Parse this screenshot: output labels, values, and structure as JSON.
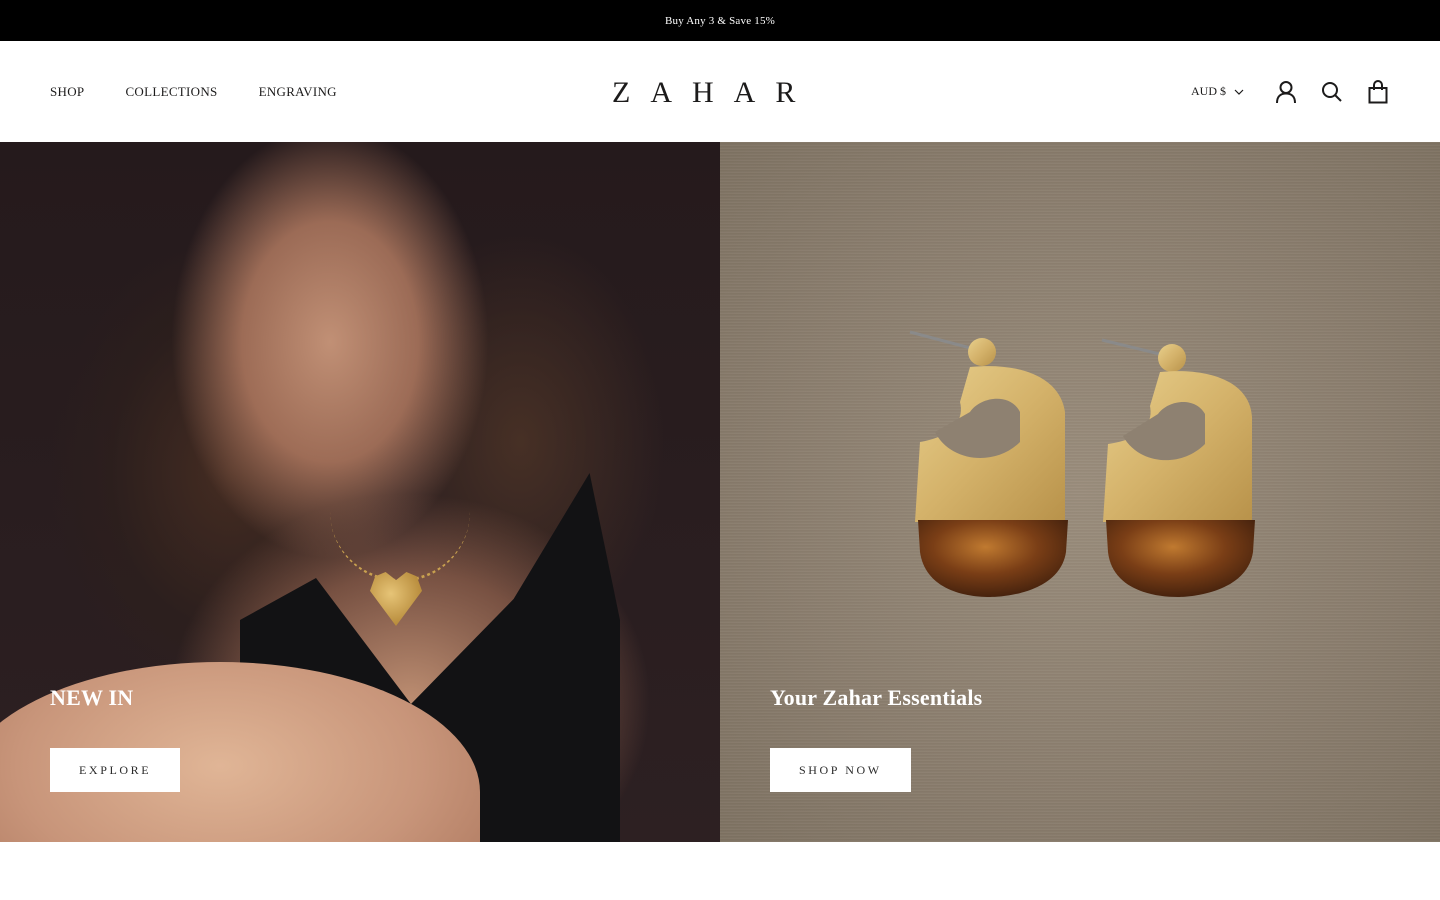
{
  "announcement": {
    "text": "Buy Any 3 & Save 15%"
  },
  "header": {
    "nav": [
      "SHOP",
      "COLLECTIONS",
      "ENGRAVING"
    ],
    "logo": "ZAHAR",
    "currency": "AUD $",
    "icons": [
      "account-icon",
      "search-icon",
      "cart-icon"
    ]
  },
  "hero": {
    "left": {
      "title": "NEW IN",
      "button": "EXPLORE"
    },
    "right": {
      "title": "Your Zahar Essentials",
      "button": "SHOP NOW"
    }
  },
  "colors": {
    "announcement_bg": "#000000",
    "button_bg": "#ffffff",
    "text": "#1c1b1b"
  }
}
